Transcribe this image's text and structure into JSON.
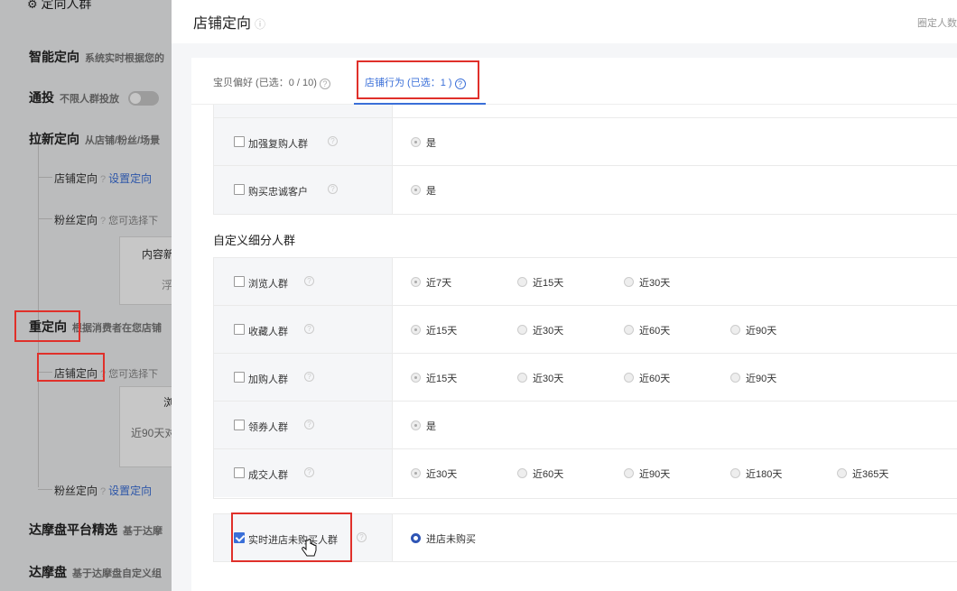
{
  "left_panel": {
    "top_label": "定向人群",
    "items": [
      {
        "title": "智能定向",
        "desc": "系统实时根据您的"
      },
      {
        "title": "通投",
        "desc": "不限人群投放"
      },
      {
        "title": "拉新定向",
        "desc": "从店铺/粉丝/场景"
      }
    ],
    "store_target": {
      "label": "店铺定向",
      "link": "设置定向"
    },
    "fans_target": {
      "label": "粉丝定向",
      "desc": "您可选择下"
    },
    "content_box": {
      "line1": "内容新",
      "line2": "浮"
    },
    "retarget": {
      "title": "重定向",
      "desc": "根据消费者在您店铺"
    },
    "retarget_store": {
      "label": "店铺定向",
      "desc": "您可选择下"
    },
    "retarget_box": {
      "line1": "浏",
      "line2": "近90天对"
    },
    "retarget_fans": {
      "label": "粉丝定向",
      "link": "设置定向"
    },
    "damo_platform": {
      "title": "达摩盘平台精选",
      "desc": "基于达摩"
    },
    "damo": {
      "title": "达摩盘",
      "desc": "基于达摩盘自定义组"
    }
  },
  "drawer": {
    "title": "店铺定向",
    "header_right": "圈定人数",
    "tabs": [
      {
        "label": "宝贝偏好 (已选：0 / 10)"
      },
      {
        "label": "店铺行为 (已选：1 )"
      }
    ],
    "rows_top": [
      {
        "label": "加强复购人群",
        "options": [
          "是"
        ]
      },
      {
        "label": "购买忠诚客户",
        "options": [
          "是"
        ]
      }
    ],
    "section_title": "自定义细分人群",
    "rows_custom": [
      {
        "label": "浏览人群",
        "options": [
          "近7天",
          "近15天",
          "近30天"
        ]
      },
      {
        "label": "收藏人群",
        "options": [
          "近15天",
          "近30天",
          "近60天",
          "近90天"
        ]
      },
      {
        "label": "加购人群",
        "options": [
          "近15天",
          "近30天",
          "近60天",
          "近90天"
        ]
      },
      {
        "label": "领券人群",
        "options": [
          "是"
        ]
      },
      {
        "label": "成交人群",
        "options": [
          "近30天",
          "近60天",
          "近90天",
          "近180天",
          "近365天"
        ]
      }
    ],
    "realtime_row": {
      "label": "实时进店未购买人群",
      "option": "进店未购买"
    }
  },
  "colors": {
    "accent": "#3a6fd8",
    "highlight_box": "#e0302a"
  }
}
